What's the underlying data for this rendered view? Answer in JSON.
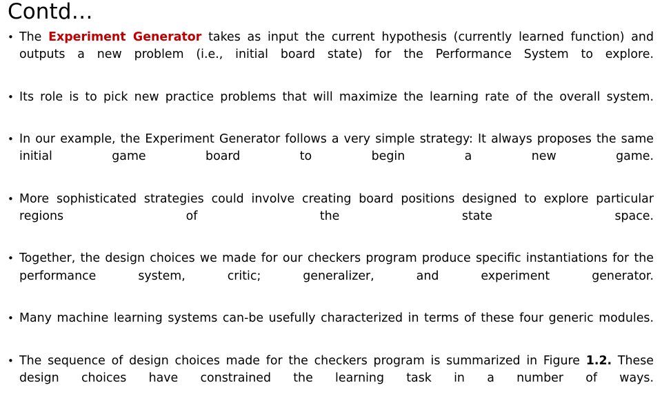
{
  "slide": {
    "title": "Contd…",
    "bullet_marker": "•",
    "accent_color": "#C00000",
    "background_color": "#FFFFFF",
    "text_color": "#000000",
    "bullets": [
      {
        "id": "experiment-generator-input-output",
        "lead": "The ",
        "highlight": "Experiment Generator",
        "tail": " takes as input the current hypothesis (currently learned function) and outputs a new problem (i.e., initial board state) for the Performance System to explore.",
        "full": "The Experiment Generator takes as input the current hypothesis (currently learned function) and outputs a new problem (i.e., initial board state) for the Performance System to explore."
      },
      {
        "id": "role-pick-practice-problems",
        "full": "Its role is to pick new practice problems that will maximize the learning rate of the overall system."
      },
      {
        "id": "simple-strategy-example",
        "full": "In our example, the Experiment Generator follows a very simple strategy: It always proposes the same initial game board to begin a new game."
      },
      {
        "id": "sophisticated-strategies",
        "full": "More sophisticated strategies could involve creating board positions designed to explore particular regions of the state space."
      },
      {
        "id": "design-choices-instantiations",
        "full": "Together, the design choices we made for our checkers program produce specific instantiations for the performance system, critic; generalizer, and experiment generator."
      },
      {
        "id": "four-generic-modules",
        "full": "Many machine learning systems can-be usefully characterized in terms of these four generic modules."
      },
      {
        "id": "sequence-summarized-figure",
        "lead": "The sequence of design choices made for the checkers program is summarized in Figure ",
        "highlight_bold": "1.2.",
        "tail": " These design choices have constrained the learning task in a number of ways.",
        "full": "The sequence of design choices made for the checkers program is summarized in Figure 1.2. These design choices have constrained the learning task in a number of ways."
      }
    ]
  }
}
